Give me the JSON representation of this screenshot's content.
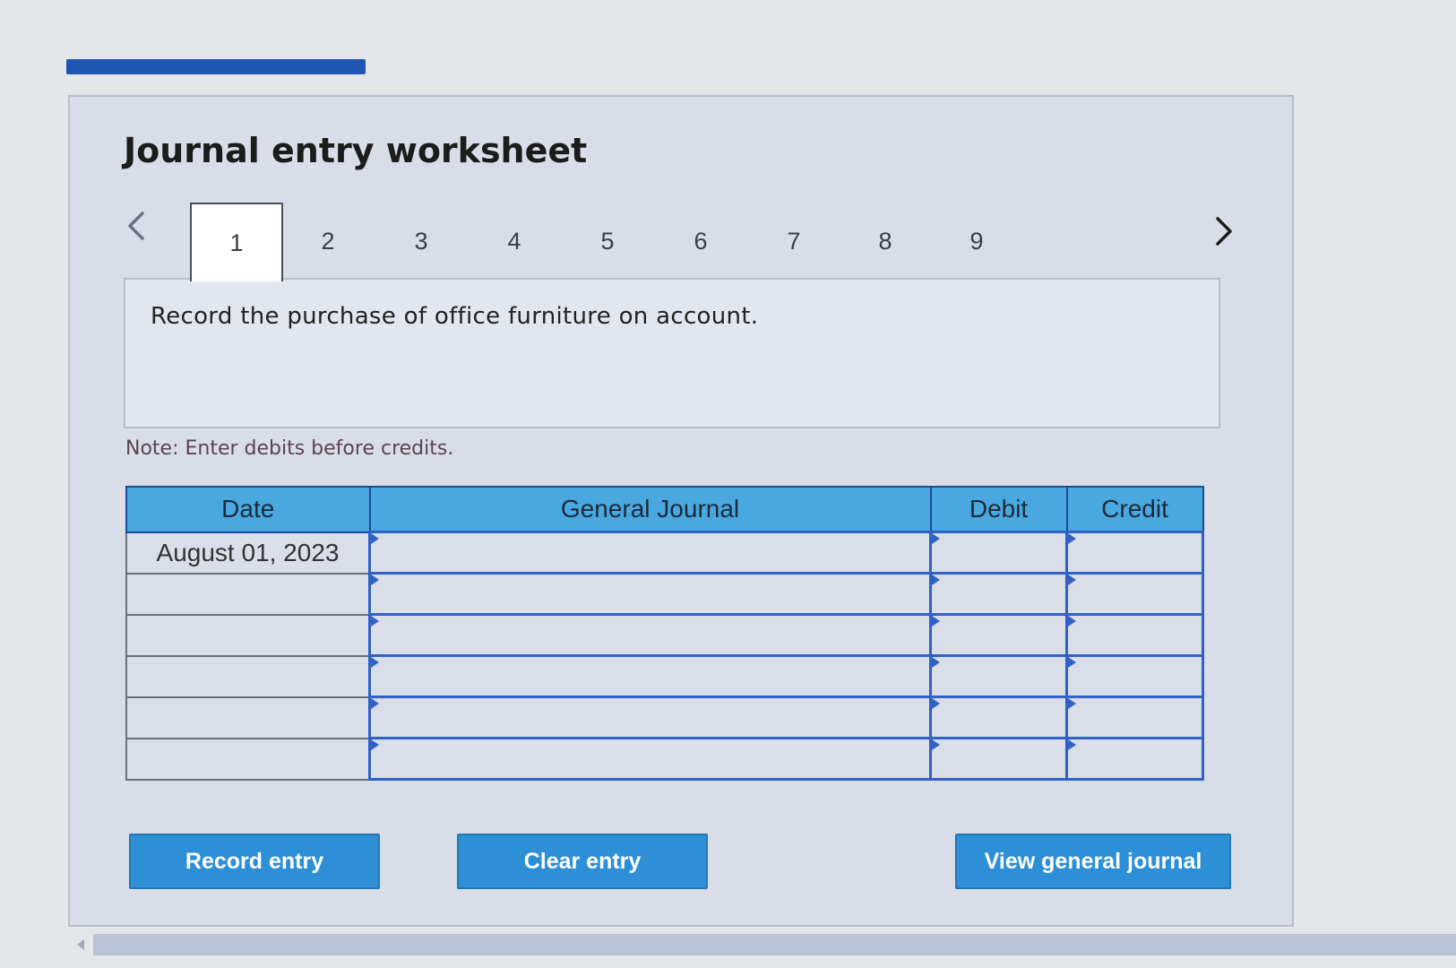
{
  "page": {
    "title": "Journal entry worksheet"
  },
  "progress": {
    "fraction": 0.22
  },
  "tabs": [
    {
      "label": "1",
      "active": true
    },
    {
      "label": "2",
      "active": false
    },
    {
      "label": "3",
      "active": false
    },
    {
      "label": "4",
      "active": false
    },
    {
      "label": "5",
      "active": false
    },
    {
      "label": "6",
      "active": false
    },
    {
      "label": "7",
      "active": false
    },
    {
      "label": "8",
      "active": false
    },
    {
      "label": "9",
      "active": false
    }
  ],
  "icons": {
    "prev": "chevron-left-icon",
    "next": "chevron-right-icon"
  },
  "question": {
    "text": "Record the purchase of office furniture on account."
  },
  "note": "Note: Enter debits before credits.",
  "table": {
    "headers": {
      "date": "Date",
      "journal": "General Journal",
      "debit": "Debit",
      "credit": "Credit"
    },
    "rows": [
      {
        "date": "August 01, 2023",
        "journal": "",
        "debit": "",
        "credit": ""
      },
      {
        "date": "",
        "journal": "",
        "debit": "",
        "credit": ""
      },
      {
        "date": "",
        "journal": "",
        "debit": "",
        "credit": ""
      },
      {
        "date": "",
        "journal": "",
        "debit": "",
        "credit": ""
      },
      {
        "date": "",
        "journal": "",
        "debit": "",
        "credit": ""
      },
      {
        "date": "",
        "journal": "",
        "debit": "",
        "credit": ""
      }
    ]
  },
  "buttons": {
    "record": "Record entry",
    "clear": "Clear entry",
    "view": "View general journal"
  },
  "colors": {
    "accent": "#2d8fd6",
    "header": "#4aa8e0",
    "progress": "#1f56b3",
    "grid": "#2f62c4"
  }
}
